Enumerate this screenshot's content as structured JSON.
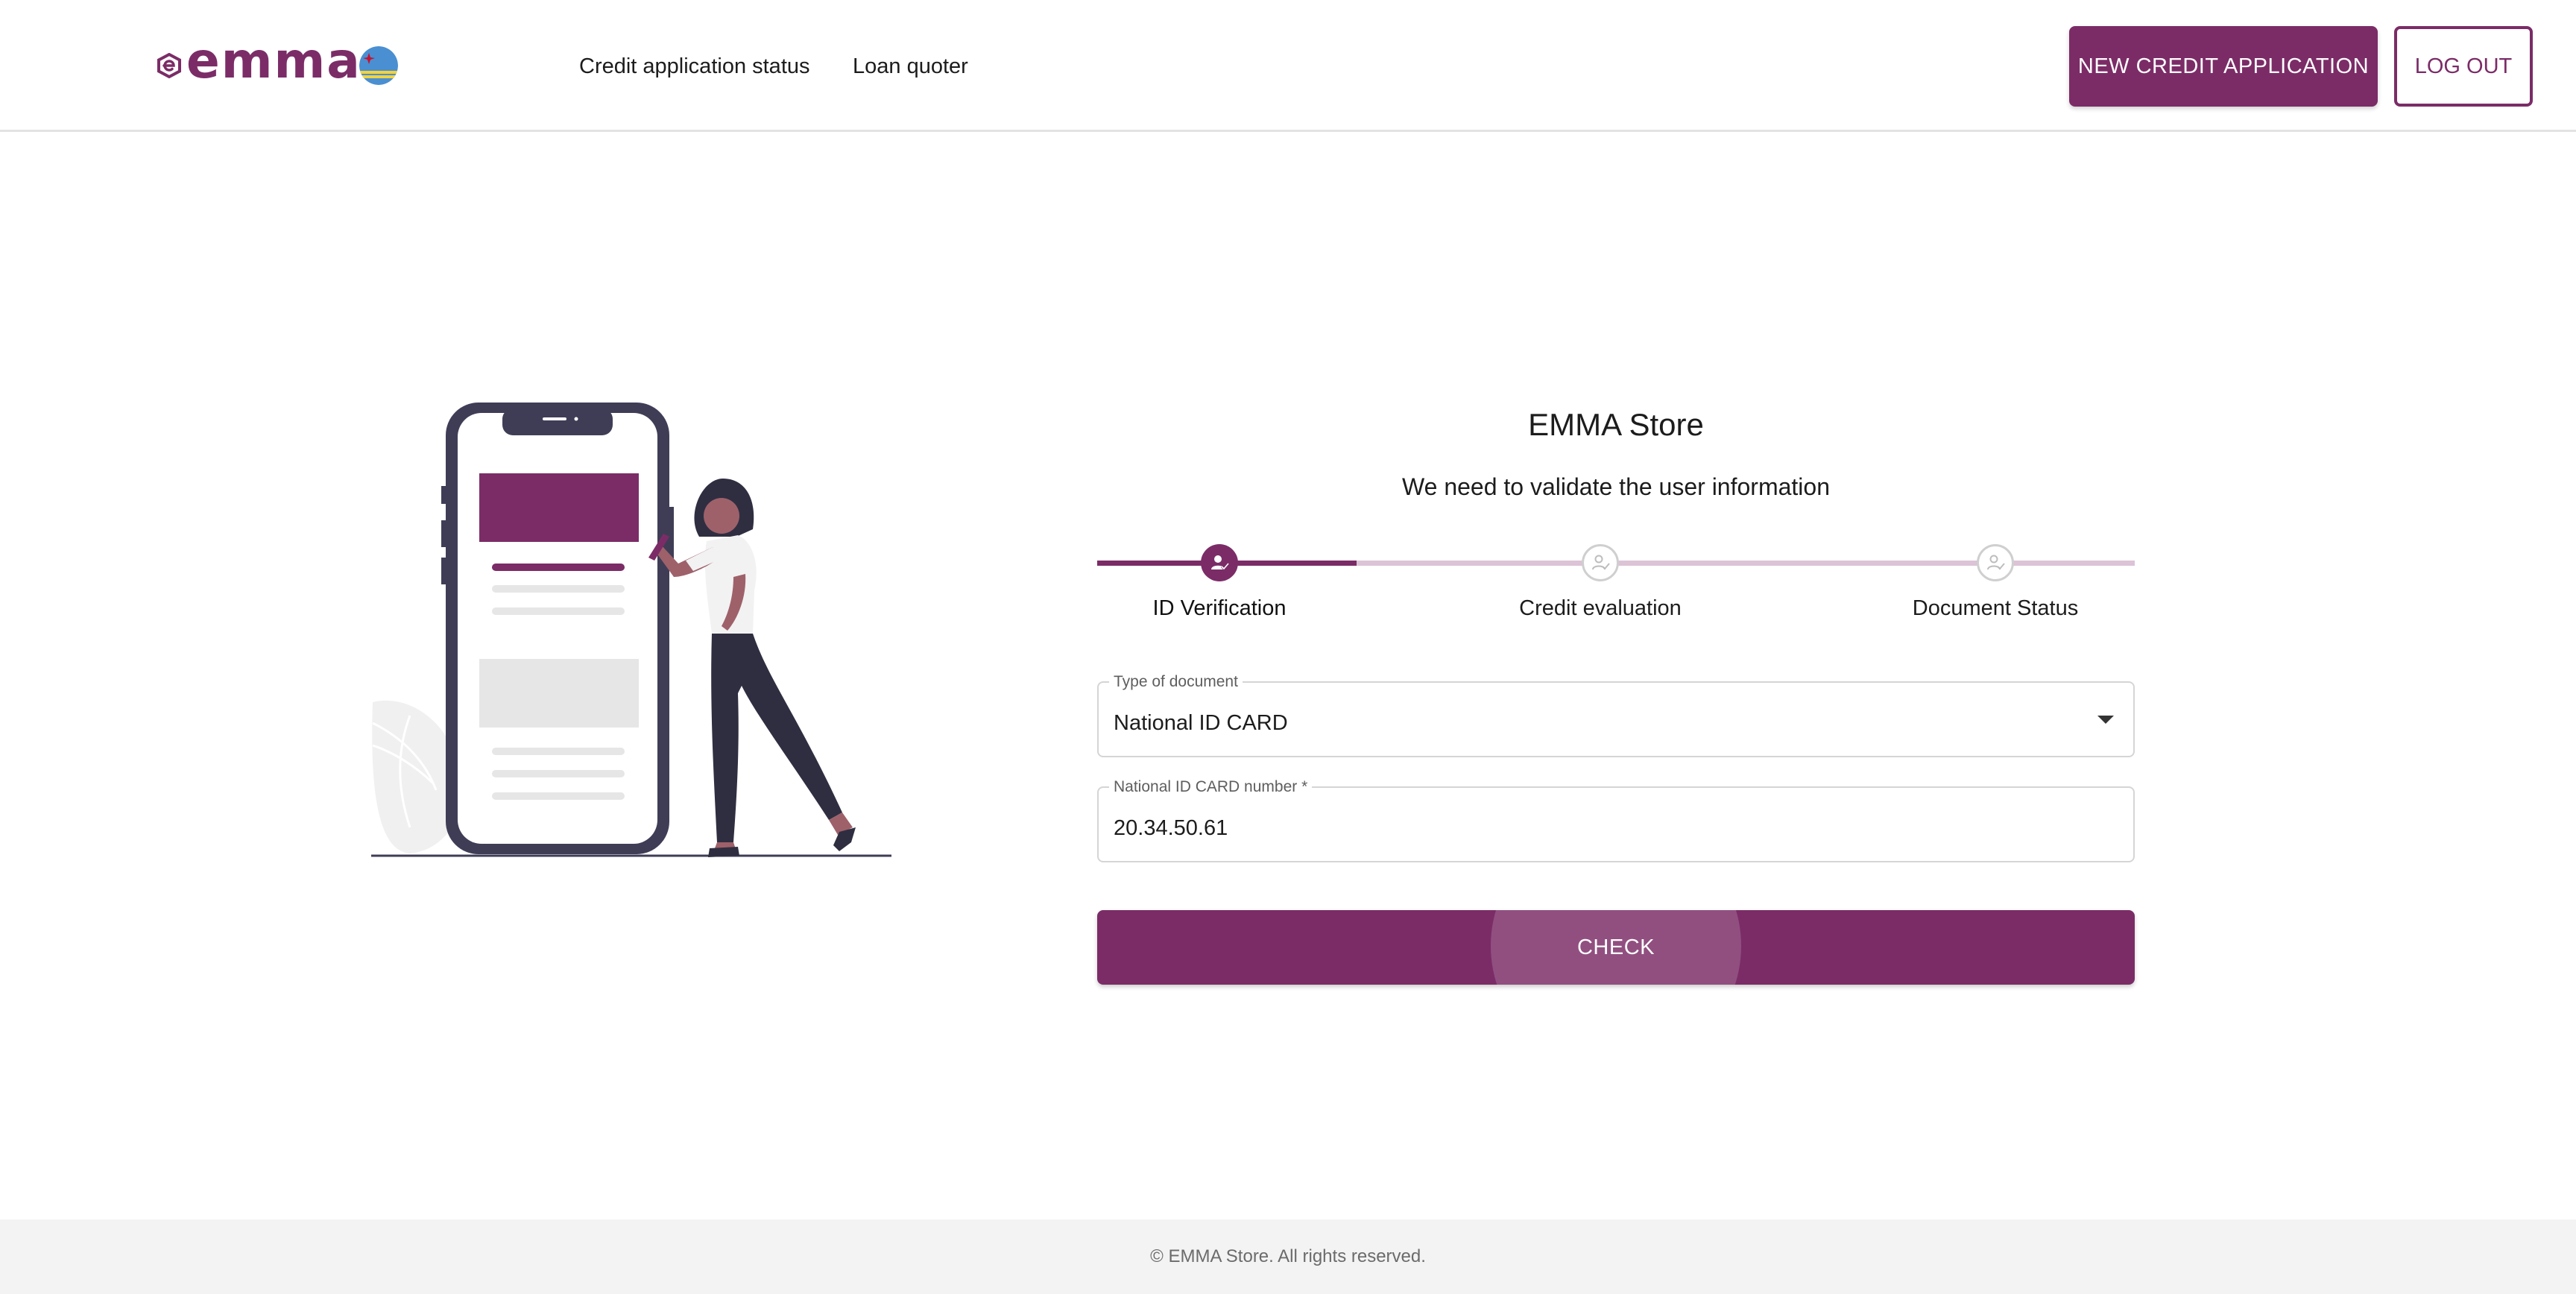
{
  "brand": {
    "logo_text": "emma",
    "logo_icon": "emma-logo-icon",
    "flag_icon": "aruba-flag-icon",
    "accent_color": "#7b2c67"
  },
  "nav": {
    "credit_status": "Credit application status",
    "loan_quoter": "Loan quoter"
  },
  "actions": {
    "new_credit": "NEW CREDIT APPLICATION",
    "logout": "LOG OUT"
  },
  "main": {
    "title": "EMMA Store",
    "subtitle": "We need to validate the user information",
    "steps": [
      {
        "label": "ID Verification",
        "icon": "user-check-icon",
        "active": true
      },
      {
        "label": "Credit evaluation",
        "icon": "user-check-icon",
        "active": false
      },
      {
        "label": "Document Status",
        "icon": "user-check-icon",
        "active": false
      }
    ],
    "progress_fraction": 0.25,
    "document_type": {
      "label": "Type of document",
      "value": "National ID CARD"
    },
    "id_number": {
      "label": "National ID CARD number *",
      "value": "20.34.50.61"
    },
    "check_button": "CHECK"
  },
  "illustration": "woman-with-phone-illustration",
  "footer": {
    "text": "© EMMA Store. All rights reserved."
  }
}
